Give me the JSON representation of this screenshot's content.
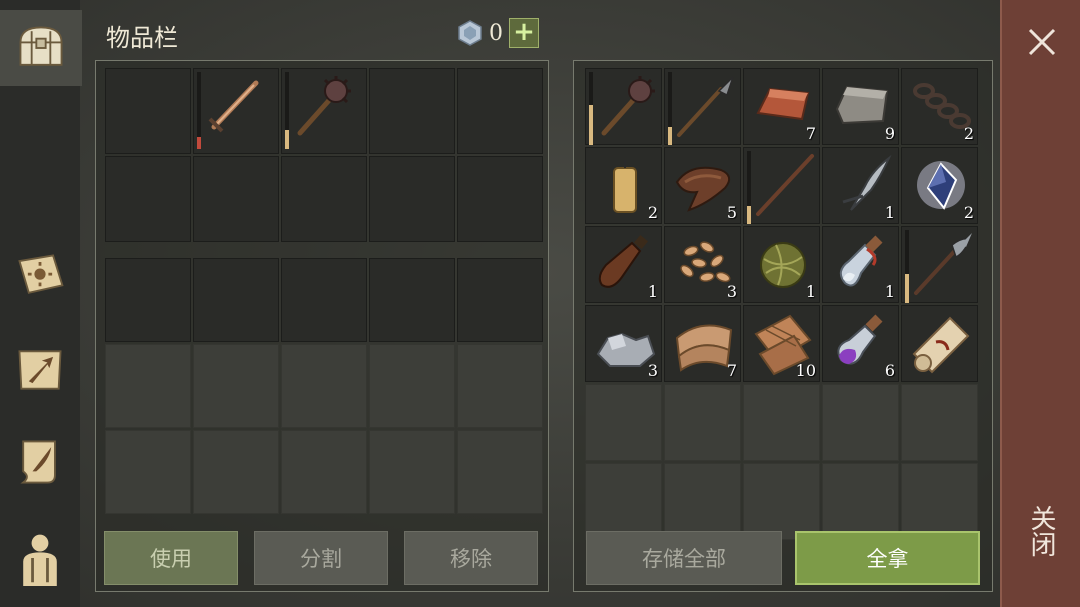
{
  "header": {
    "title": "物品栏",
    "gem_count": "0",
    "add_label": "+"
  },
  "left_tabs": [
    {
      "name": "chest-icon"
    },
    {
      "name": "journal-sun-icon"
    },
    {
      "name": "map-arrow-icon"
    },
    {
      "name": "scroll-quill-icon"
    },
    {
      "name": "character-icon"
    }
  ],
  "inventory": {
    "slots": [
      {
        "item": ""
      },
      {
        "item": "sword-icon",
        "durability": 0.15,
        "durability_color": "#c24a3c"
      },
      {
        "item": "mace-icon",
        "durability": 0.25,
        "durability_color": "#d9b980"
      }
    ]
  },
  "storage": {
    "items": [
      {
        "item": "mace-icon",
        "count": "",
        "durability": 0.55
      },
      {
        "item": "spear-icon",
        "count": "",
        "durability": 0.25
      },
      {
        "item": "copper-ingot-icon",
        "count": "7"
      },
      {
        "item": "stone-block-icon",
        "count": "9"
      },
      {
        "item": "chain-icon",
        "count": "2"
      },
      {
        "item": "candle-icon",
        "count": "2"
      },
      {
        "item": "leather-icon",
        "count": "5"
      },
      {
        "item": "stick-icon",
        "count": "",
        "durability": 0.25
      },
      {
        "item": "hook-blade-icon",
        "count": "1"
      },
      {
        "item": "crystal-icon",
        "count": "2"
      },
      {
        "item": "bottle-icon",
        "count": "1"
      },
      {
        "item": "seeds-icon",
        "count": "3"
      },
      {
        "item": "fiber-ball-icon",
        "count": "1"
      },
      {
        "item": "potion-icon",
        "count": "1"
      },
      {
        "item": "halberd-icon",
        "count": "",
        "durability": 0.4
      },
      {
        "item": "silver-ore-icon",
        "count": "3"
      },
      {
        "item": "cloth-icon",
        "count": "7"
      },
      {
        "item": "rag-icon",
        "count": "10"
      },
      {
        "item": "purple-potion-icon",
        "count": "6"
      },
      {
        "item": "scroll-icon",
        "count": ""
      }
    ]
  },
  "buttons": {
    "use": "使用",
    "split": "分割",
    "remove": "移除",
    "store_all": "存储全部",
    "take_all": "全拿"
  },
  "close": {
    "label": "关闭"
  },
  "colors": {
    "accent_green": "#7d9b48",
    "close_red": "#6e4036",
    "durability_bar": "#d9b980"
  }
}
